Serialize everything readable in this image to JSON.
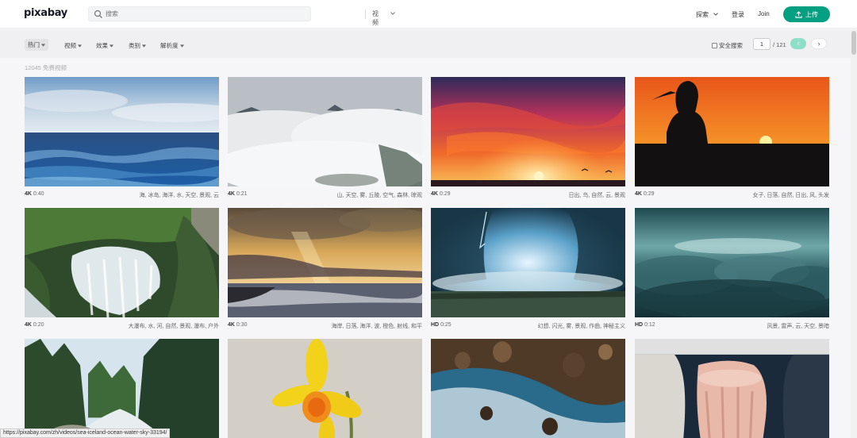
{
  "header": {
    "logo": "pixabay",
    "search_placeholder": "搜索",
    "search_type": "视频",
    "explore": "探索",
    "login": "登录",
    "join": "Join",
    "upload": "上传"
  },
  "filters": {
    "items": [
      "热门",
      "视频",
      "效果",
      "类别",
      "解析度"
    ],
    "safe_search": "安全搜索",
    "page_current": "1",
    "page_total": "/ 121",
    "prev": "‹",
    "next": "›"
  },
  "result_count": "12045 免费视频",
  "videos": [
    {
      "quality": "4K",
      "duration": "0:40",
      "tags": "海, 冰岛, 海洋, 水, 天空, 景观, 云"
    },
    {
      "quality": "4K",
      "duration": "0:21",
      "tags": "山, 天空, 雾, 丘陵, 空气, 森林, 晾观"
    },
    {
      "quality": "4K",
      "duration": "0:29",
      "tags": "日出, 鸟, 自然, 云, 景观"
    },
    {
      "quality": "4K",
      "duration": "0:29",
      "tags": "女子, 日落, 自然, 日出, 风, 头发"
    },
    {
      "quality": "4K",
      "duration": "0:20",
      "tags": "大瀑布, 水, 河, 自然, 景观, 瀑布, 户外"
    },
    {
      "quality": "4K",
      "duration": "0:30",
      "tags": "海岸, 日落, 海洋, 波, 橙色, 射线, 和平"
    },
    {
      "quality": "HD",
      "duration": "0:25",
      "tags": "幻想, 闪光, 雾, 景观, 作曲, 神秘主义"
    },
    {
      "quality": "HD",
      "duration": "0:12",
      "tags": "风景, 雷声, 云, 天空, 景暗"
    },
    {
      "quality": "",
      "duration": "",
      "tags": ""
    },
    {
      "quality": "",
      "duration": "",
      "tags": ""
    },
    {
      "quality": "",
      "duration": "",
      "tags": ""
    },
    {
      "quality": "",
      "duration": "",
      "tags": ""
    }
  ],
  "status_url": "https://pixabay.com/zh/videos/sea-iceland-ocean-water-sky-33194/"
}
